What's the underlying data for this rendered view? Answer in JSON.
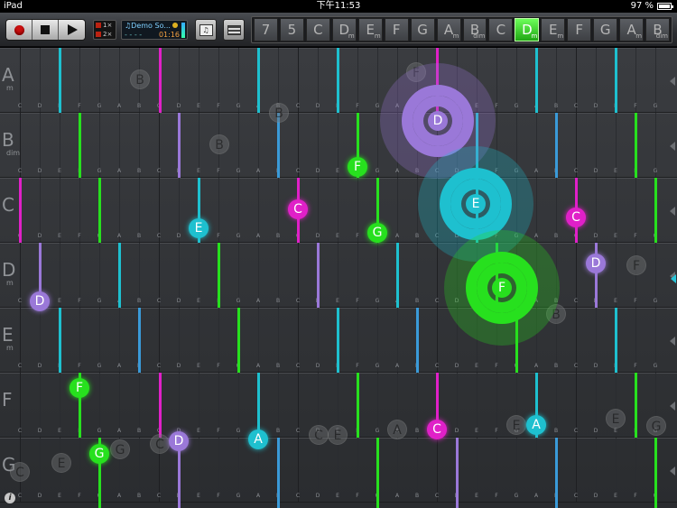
{
  "status": {
    "device": "iPad",
    "time": "下午11:53",
    "battery": "97 %"
  },
  "transport": {
    "record": "record-button",
    "stop": "stop-button",
    "play": "play-button"
  },
  "speed": {
    "first": "1×",
    "second": "2×"
  },
  "song": {
    "name": "Demo So...",
    "meta": "- - - -",
    "time": "01:16"
  },
  "chords": [
    {
      "root": "7",
      "quality": ""
    },
    {
      "root": "5",
      "quality": ""
    },
    {
      "root": "C",
      "quality": ""
    },
    {
      "root": "D",
      "quality": "m"
    },
    {
      "root": "E",
      "quality": "m"
    },
    {
      "root": "F",
      "quality": ""
    },
    {
      "root": "G",
      "quality": ""
    },
    {
      "root": "A",
      "quality": "m"
    },
    {
      "root": "B",
      "quality": "dim"
    },
    {
      "root": "C",
      "quality": ""
    },
    {
      "root": "D",
      "quality": "m",
      "active": true
    },
    {
      "root": "E",
      "quality": "m"
    },
    {
      "root": "F",
      "quality": ""
    },
    {
      "root": "G",
      "quality": ""
    },
    {
      "root": "A",
      "quality": "m"
    },
    {
      "root": "B",
      "quality": "dim"
    }
  ],
  "rows": [
    {
      "label": "A",
      "quality": "m"
    },
    {
      "label": "B",
      "quality": "dim"
    },
    {
      "label": "C",
      "quality": ""
    },
    {
      "label": "D",
      "quality": "m"
    },
    {
      "label": "E",
      "quality": "m"
    },
    {
      "label": "F",
      "quality": ""
    },
    {
      "label": "G",
      "quality": ""
    }
  ],
  "scale_notes": [
    "C",
    "D",
    "E",
    "F",
    "G",
    "A",
    "B",
    "C",
    "D",
    "E",
    "F",
    "G",
    "A",
    "B",
    "C",
    "D",
    "E",
    "F",
    "G",
    "A",
    "B",
    "C",
    "D",
    "E",
    "F",
    "G",
    "A",
    "B",
    "C",
    "D",
    "E",
    "F",
    "G",
    "A",
    "B"
  ],
  "colors": {
    "magenta": "#e020c8",
    "cyan": "#1ec0cf",
    "green": "#27e01e",
    "purple": "#9a78d8",
    "blue": "#3a9ad8"
  },
  "rings": [
    {
      "note": "D",
      "color": "purple"
    },
    {
      "note": "E",
      "color": "cyan"
    },
    {
      "note": "F",
      "color": "green"
    }
  ],
  "balls": [
    {
      "note": "F",
      "color": "green"
    },
    {
      "note": "E",
      "color": "cyan"
    },
    {
      "note": "C",
      "color": "magenta"
    },
    {
      "note": "G",
      "color": "green"
    },
    {
      "note": "C",
      "color": "magenta"
    },
    {
      "note": "D",
      "color": "purple"
    },
    {
      "note": "D",
      "color": "purple"
    },
    {
      "note": "F",
      "color": "green"
    },
    {
      "note": "C",
      "color": "magenta"
    },
    {
      "note": "A",
      "color": "cyan"
    },
    {
      "note": "G",
      "color": "green"
    },
    {
      "note": "D",
      "color": "purple"
    },
    {
      "note": "A",
      "color": "cyan"
    }
  ],
  "ghosts": [
    "B",
    "B",
    "B",
    "F",
    "F",
    "B",
    "E",
    "C",
    "C",
    "E",
    "A",
    "C",
    "E",
    "G",
    "E",
    "G"
  ],
  "info": "i"
}
